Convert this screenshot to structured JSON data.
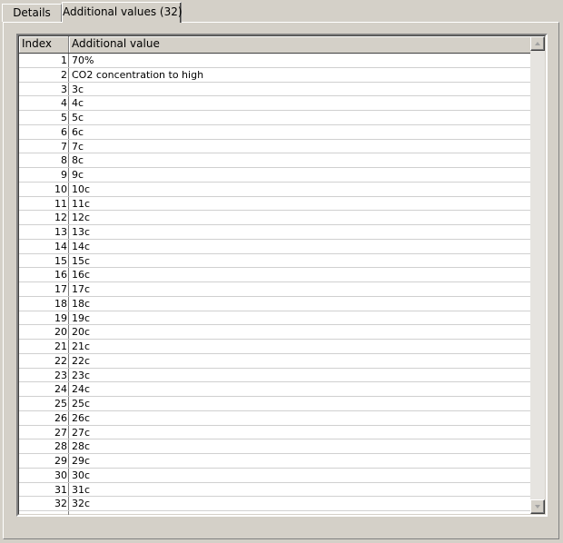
{
  "tabs": [
    {
      "label": "Details",
      "active": false
    },
    {
      "label": "Additional values (32)",
      "active": true
    }
  ],
  "table": {
    "columns": [
      "Index",
      "Additional value"
    ],
    "rows": [
      {
        "index": "1",
        "value": "70%"
      },
      {
        "index": "2",
        "value": "CO2 concentration to high"
      },
      {
        "index": "3",
        "value": "3c"
      },
      {
        "index": "4",
        "value": "4c"
      },
      {
        "index": "5",
        "value": "5c"
      },
      {
        "index": "6",
        "value": "6c"
      },
      {
        "index": "7",
        "value": "7c"
      },
      {
        "index": "8",
        "value": "8c"
      },
      {
        "index": "9",
        "value": "9c"
      },
      {
        "index": "10",
        "value": "10c"
      },
      {
        "index": "11",
        "value": "11c"
      },
      {
        "index": "12",
        "value": "12c"
      },
      {
        "index": "13",
        "value": "13c"
      },
      {
        "index": "14",
        "value": "14c"
      },
      {
        "index": "15",
        "value": "15c"
      },
      {
        "index": "16",
        "value": "16c"
      },
      {
        "index": "17",
        "value": "17c"
      },
      {
        "index": "18",
        "value": "18c"
      },
      {
        "index": "19",
        "value": "19c"
      },
      {
        "index": "20",
        "value": "20c"
      },
      {
        "index": "21",
        "value": "21c"
      },
      {
        "index": "22",
        "value": "22c"
      },
      {
        "index": "23",
        "value": "23c"
      },
      {
        "index": "24",
        "value": "24c"
      },
      {
        "index": "25",
        "value": "25c"
      },
      {
        "index": "26",
        "value": "26c"
      },
      {
        "index": "27",
        "value": "27c"
      },
      {
        "index": "28",
        "value": "28c"
      },
      {
        "index": "29",
        "value": "29c"
      },
      {
        "index": "30",
        "value": "30c"
      },
      {
        "index": "31",
        "value": "31c"
      },
      {
        "index": "32",
        "value": "32c"
      }
    ]
  },
  "scrollbar": {
    "up_icon": "scroll-up-arrow-icon",
    "down_icon": "scroll-down-arrow-icon"
  }
}
